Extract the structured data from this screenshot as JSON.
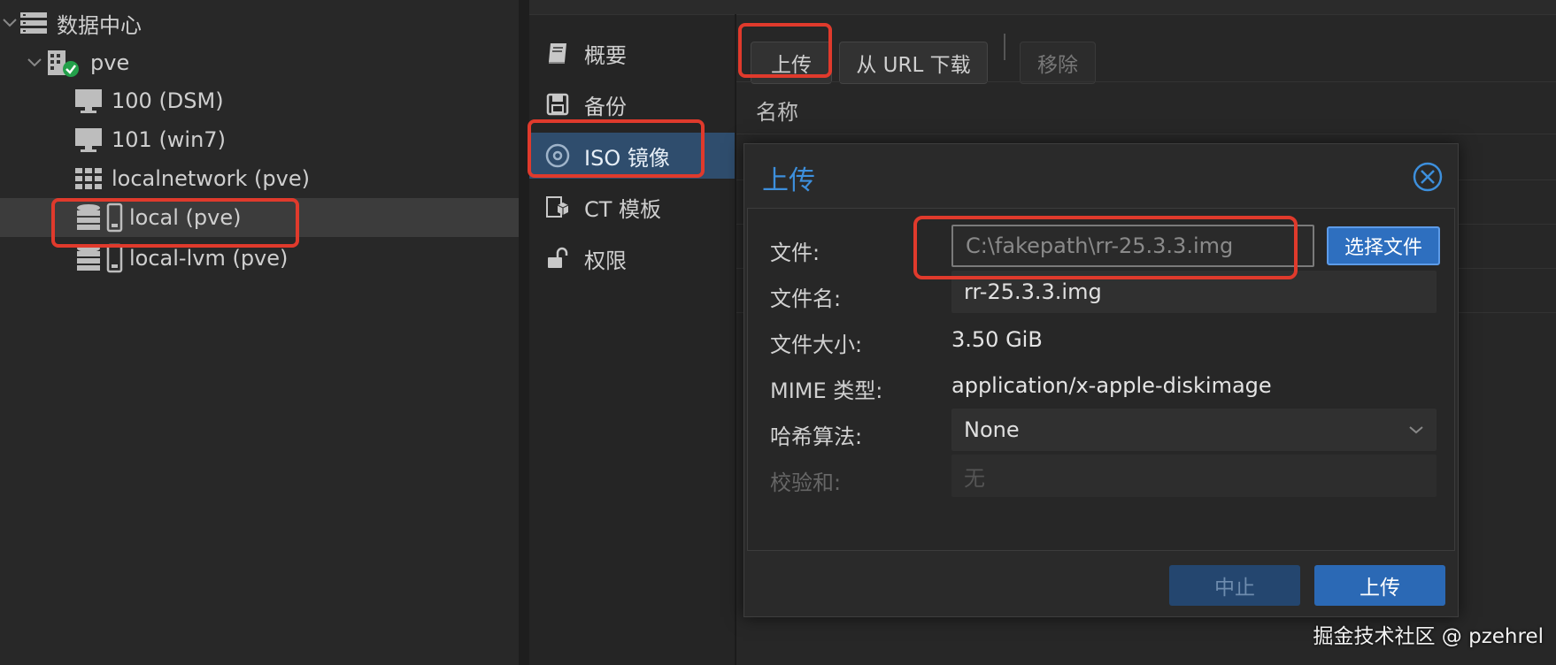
{
  "tree": {
    "items": [
      {
        "label": "数据中心",
        "icon": "datacenter-icon"
      },
      {
        "label": "pve",
        "icon": "node-online-icon"
      },
      {
        "label": "100 (DSM)",
        "icon": "vm-monitor-icon"
      },
      {
        "label": "101 (win7)",
        "icon": "vm-monitor-icon"
      },
      {
        "label": "localnetwork (pve)",
        "icon": "network-grid-icon"
      },
      {
        "label": "local (pve)",
        "icon": "storage-icon",
        "selected": true
      },
      {
        "label": "local-lvm (pve)",
        "icon": "storage-icon"
      }
    ]
  },
  "nav": {
    "items": [
      {
        "label": "概要",
        "icon": "book-icon"
      },
      {
        "label": "备份",
        "icon": "floppy-icon"
      },
      {
        "label": "ISO 镜像",
        "icon": "disc-icon",
        "active": true
      },
      {
        "label": "CT 模板",
        "icon": "cube-icon"
      },
      {
        "label": "权限",
        "icon": "unlock-icon"
      }
    ]
  },
  "toolbar": {
    "upload_label": "上传",
    "download_url_label": "从 URL 下载",
    "remove_label": "移除"
  },
  "grid": {
    "column_name": "名称"
  },
  "dialog": {
    "title": "上传",
    "file_label": "文件:",
    "file_value": "C:\\fakepath\\rr-25.3.3.img",
    "pick_file_label": "选择文件",
    "filename_label": "文件名:",
    "filename_value": "rr-25.3.3.img",
    "filesize_label": "文件大小:",
    "filesize_value": "3.50 GiB",
    "mime_label": "MIME 类型:",
    "mime_value": "application/x-apple-diskimage",
    "hash_label": "哈希算法:",
    "hash_value": "None",
    "checksum_label": "校验和:",
    "checksum_placeholder": "无",
    "abort_label": "中止",
    "upload_label": "上传"
  },
  "watermark": "掘金技术社区 @ pzehrel",
  "colors": {
    "accent": "#3d8fdc",
    "primary_button": "#2b69b5",
    "annotation_red": "#e03a2c",
    "active_nav": "#2f4d6d"
  }
}
